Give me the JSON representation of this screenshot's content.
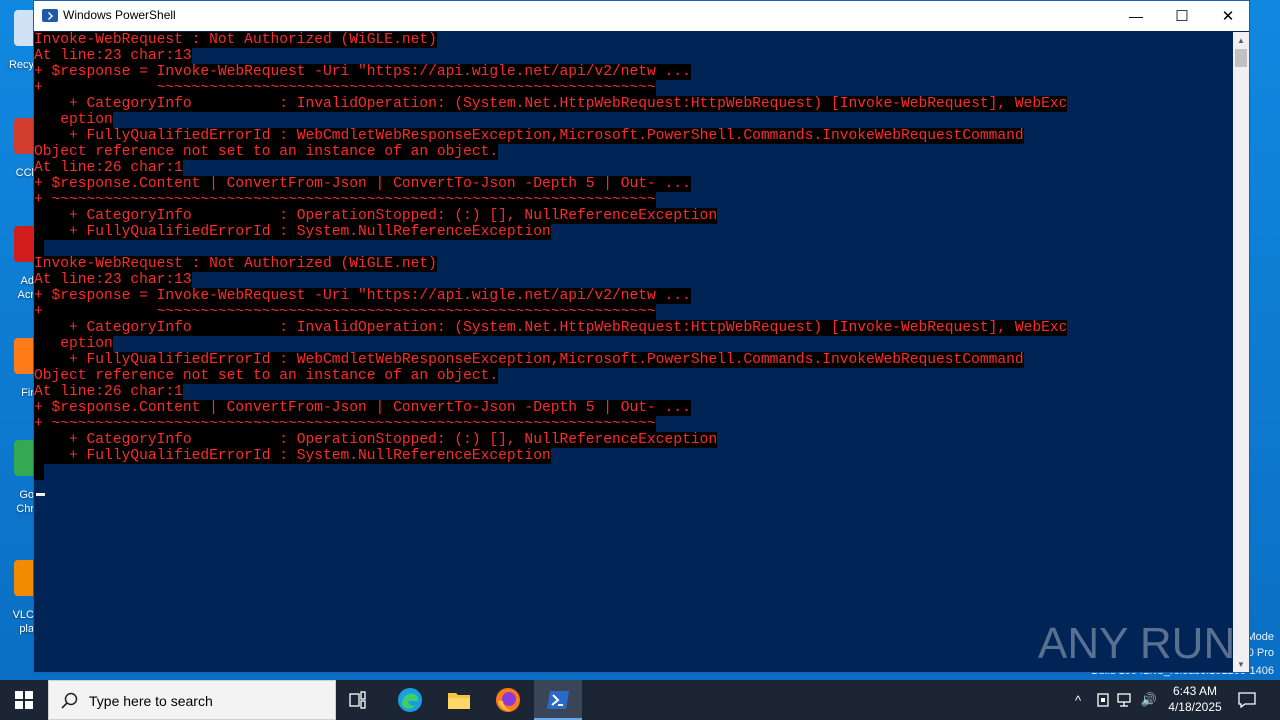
{
  "window": {
    "title": "Windows PowerShell",
    "minimize_glyph": "—",
    "maximize_glyph": "☐",
    "close_glyph": "✕",
    "scroll_up_glyph": "▲",
    "scroll_down_glyph": "▼"
  },
  "console": {
    "lines": [
      "Invoke-WebRequest : Not Authorized (WiGLE.net)",
      "At line:23 char:13",
      "+ $response = Invoke-WebRequest -Uri \"https://api.wigle.net/api/v2/netw ...",
      "+             ~~~~~~~~~~~~~~~~~~~~~~~~~~~~~~~~~~~~~~~~~~~~~~~~~~~~~~~~~",
      "    + CategoryInfo          : InvalidOperation: (System.Net.HttpWebRequest:HttpWebRequest) [Invoke-WebRequest], WebExc",
      "   eption",
      "    + FullyQualifiedErrorId : WebCmdletWebResponseException,Microsoft.PowerShell.Commands.InvokeWebRequestCommand",
      "Object reference not set to an instance of an object.",
      "At line:26 char:1",
      "+ $response.Content | ConvertFrom-Json | ConvertTo-Json -Depth 5 | Out- ...",
      "+ ~~~~~~~~~~~~~~~~~~~~~~~~~~~~~~~~~~~~~~~~~~~~~~~~~~~~~~~~~~~~~~~~~~~~~",
      "    + CategoryInfo          : OperationStopped: (:) [], NullReferenceException",
      "    + FullyQualifiedErrorId : System.NullReferenceException",
      " ",
      "Invoke-WebRequest : Not Authorized (WiGLE.net)",
      "At line:23 char:13",
      "+ $response = Invoke-WebRequest -Uri \"https://api.wigle.net/api/v2/netw ...",
      "+             ~~~~~~~~~~~~~~~~~~~~~~~~~~~~~~~~~~~~~~~~~~~~~~~~~~~~~~~~~",
      "    + CategoryInfo          : InvalidOperation: (System.Net.HttpWebRequest:HttpWebRequest) [Invoke-WebRequest], WebExc",
      "   eption",
      "    + FullyQualifiedErrorId : WebCmdletWebResponseException,Microsoft.PowerShell.Commands.InvokeWebRequestCommand",
      "Object reference not set to an instance of an object.",
      "At line:26 char:1",
      "+ $response.Content | ConvertFrom-Json | ConvertTo-Json -Depth 5 | Out- ...",
      "+ ~~~~~~~~~~~~~~~~~~~~~~~~~~~~~~~~~~~~~~~~~~~~~~~~~~~~~~~~~~~~~~~~~~~~~",
      "    + CategoryInfo          : OperationStopped: (:) [], NullReferenceException",
      "    + FullyQualifiedErrorId : System.NullReferenceException",
      " "
    ]
  },
  "desktop": {
    "icons": [
      {
        "label": "Recy",
        "icon": "recycle-bin-icon",
        "color": "#cfe3f5"
      },
      {
        "label": "CCl",
        "icon": "ccleaner-icon",
        "color": "#d23c2c"
      },
      {
        "label": "Ad",
        "label2": "Acr",
        "icon": "acrobat-icon",
        "color": "#d21d1d"
      },
      {
        "label": "Fir",
        "icon": "firefox-icon",
        "color": "#ff7a18"
      },
      {
        "label": "Go",
        "label2": "Chr",
        "icon": "chrome-icon",
        "color": "#34a853"
      },
      {
        "label": "VLC",
        "label2": "pla",
        "icon": "vlc-icon",
        "color": "#f28b00"
      }
    ],
    "watermark_lines": [
      "Mode",
      "0 Pro",
      "Build 19041.vb_release.191206-1406"
    ]
  },
  "watermark": {
    "brand": "ANY RUN"
  },
  "taskbar": {
    "search_placeholder": "Type here to search",
    "apps": [
      {
        "name": "task-view",
        "icon": "task-view-icon"
      },
      {
        "name": "edge",
        "icon": "edge-icon"
      },
      {
        "name": "file-explorer",
        "icon": "folder-icon"
      },
      {
        "name": "firefox",
        "icon": "firefox-icon"
      },
      {
        "name": "powershell",
        "icon": "powershell-icon",
        "active": true
      }
    ],
    "clock_time": "6:43 AM",
    "clock_date": "4/18/2025",
    "tray_chevron": "^",
    "tray_volume": "🔊"
  },
  "colors": {
    "console_bg": "#012456",
    "error_fg": "#ff2a2a",
    "error_bg": "#000000",
    "accent": "#0a78d4"
  }
}
